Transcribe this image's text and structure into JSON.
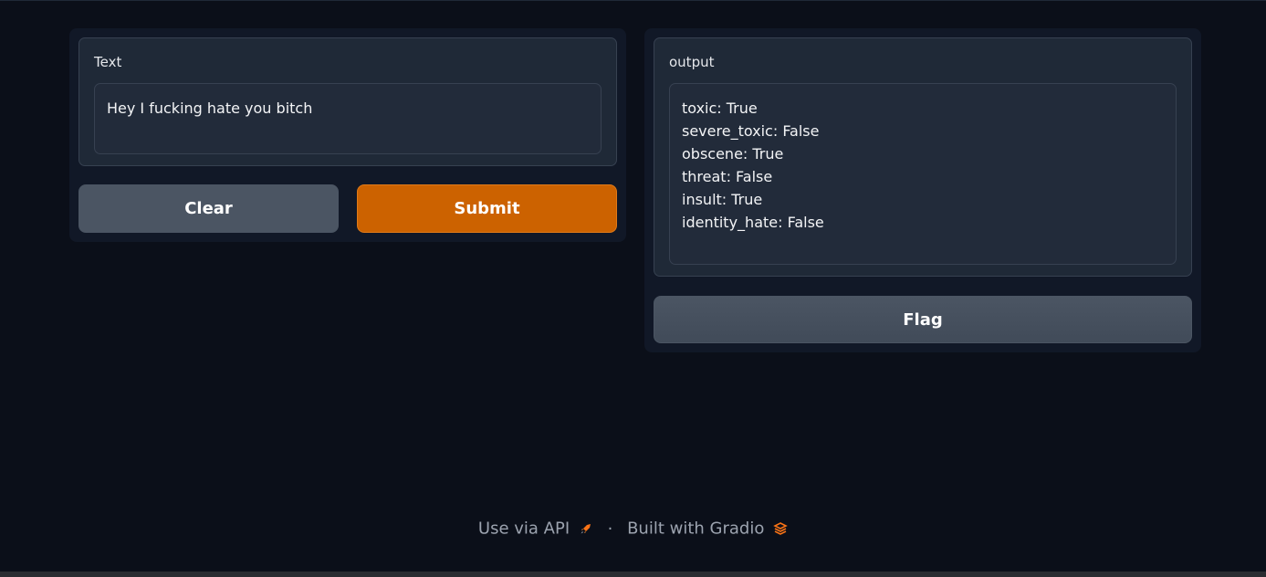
{
  "input": {
    "label": "Text",
    "value": "Hey I fucking hate you bitch"
  },
  "buttons": {
    "clear": "Clear",
    "submit": "Submit",
    "flag": "Flag"
  },
  "output": {
    "label": "output",
    "value": "toxic: True\nsevere_toxic: False\nobscene: True\nthreat: False\ninsult: True\nidentity_hate: False"
  },
  "footer": {
    "api_link": "Use via API",
    "separator": "·",
    "built_with": "Built with Gradio"
  },
  "colors": {
    "background": "#0b0f19",
    "submit": "#cc6200",
    "accent": "#f97316"
  },
  "icons": {
    "api": "rocket-icon",
    "gradio": "gradio-logo-icon"
  }
}
